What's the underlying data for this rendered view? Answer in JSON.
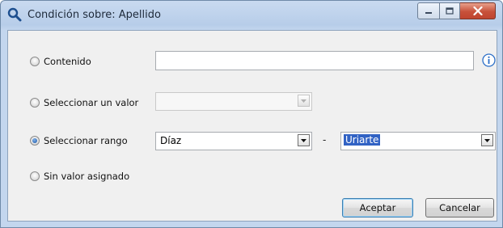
{
  "window": {
    "title": "Condición sobre: Apellido",
    "icon": "search-icon"
  },
  "options": [
    {
      "label": "Contenido",
      "selected": false
    },
    {
      "label": "Seleccionar un valor",
      "selected": false
    },
    {
      "label": "Seleccionar rango",
      "selected": true
    },
    {
      "label": "Sin valor asignado",
      "selected": false
    }
  ],
  "contenido": {
    "value": ""
  },
  "valor": {
    "value": ""
  },
  "rango": {
    "from": "Díaz",
    "separator": "-",
    "to": "Uriarte"
  },
  "buttons": {
    "accept": "Aceptar",
    "cancel": "Cancelar"
  },
  "colors": {
    "title_gradient": "#c9daf0",
    "close_button": "#c7513a",
    "selection": "#3162c4",
    "radio_checked": "#1b56a6",
    "info_icon": "#2b6ec7"
  }
}
